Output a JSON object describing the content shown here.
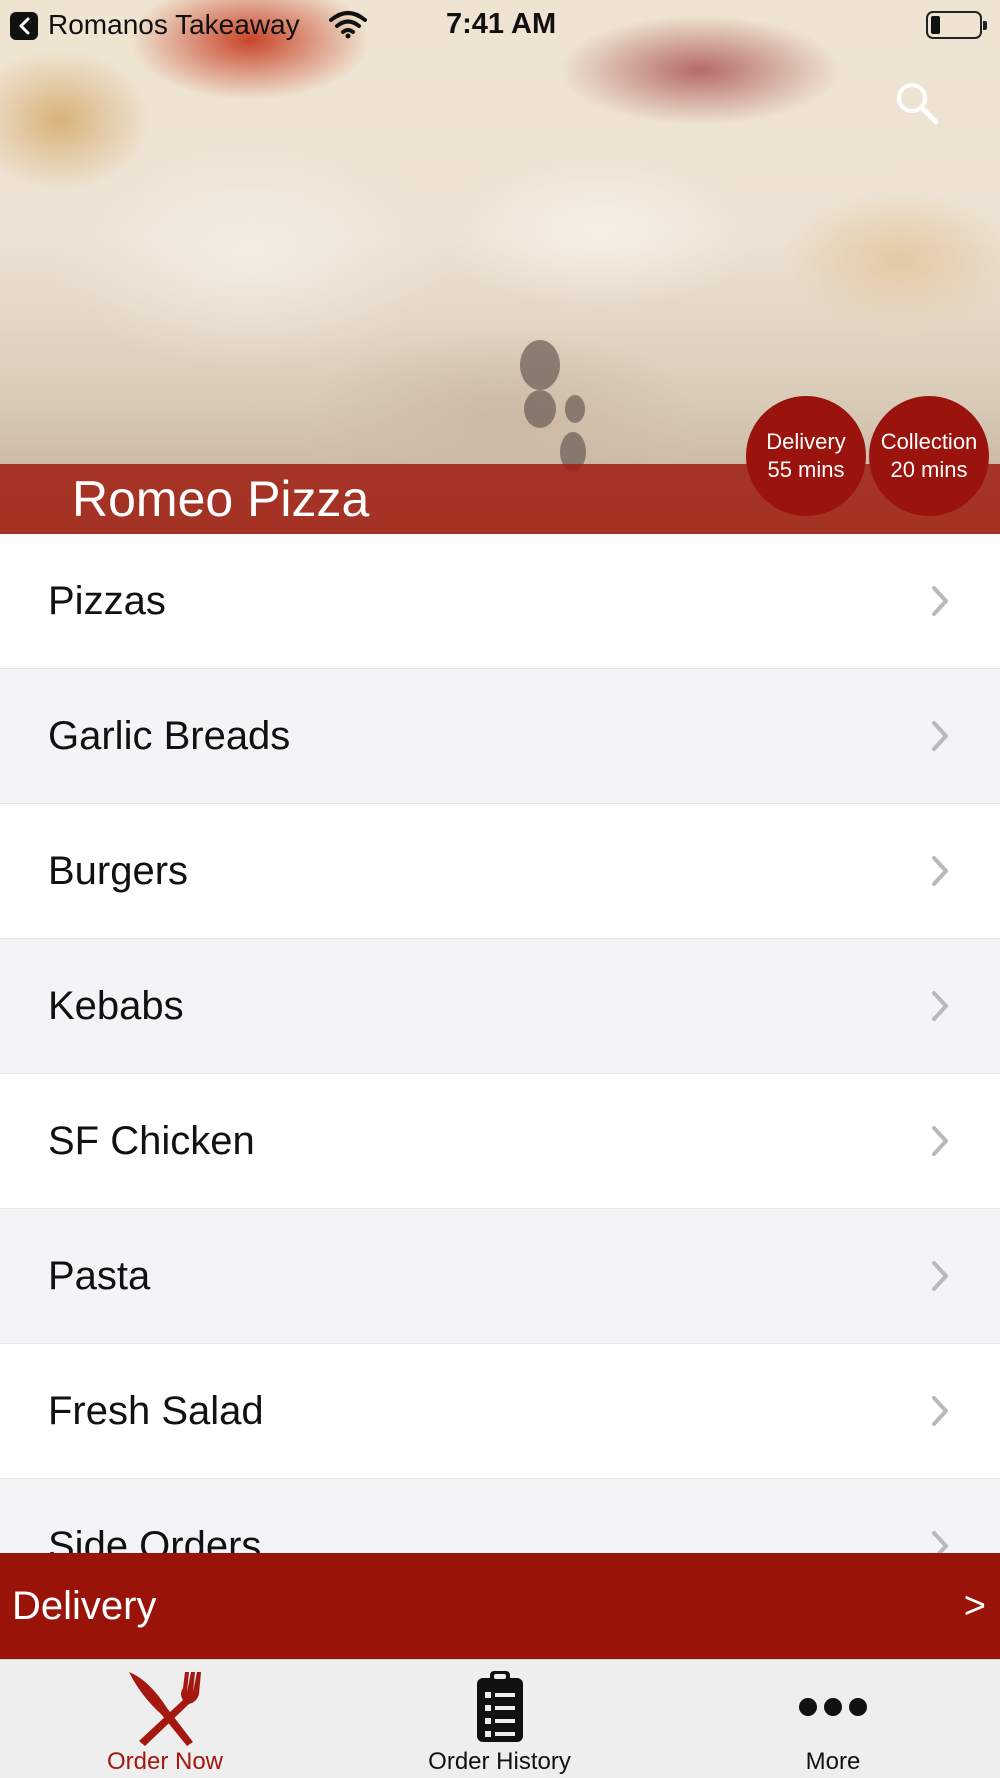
{
  "status_bar": {
    "back_app": "Romanos Takeaway",
    "time": "7:41 AM",
    "back_icon": "back-arrow-icon",
    "wifi_icon": "wifi-icon",
    "battery_icon": "battery-icon",
    "battery_level": 0.2
  },
  "header": {
    "title": "Romeo Pizza",
    "search_icon": "search-icon",
    "delivery": {
      "label": "Delivery",
      "time": "55 mins"
    },
    "collection": {
      "label": "Collection",
      "time": "20 mins"
    }
  },
  "menu": {
    "items": [
      {
        "label": "Pizzas"
      },
      {
        "label": "Garlic Breads"
      },
      {
        "label": "Burgers"
      },
      {
        "label": "Kebabs"
      },
      {
        "label": "SF Chicken"
      },
      {
        "label": "Pasta"
      },
      {
        "label": "Fresh Salad"
      },
      {
        "label": "Side Orders"
      }
    ],
    "chevron_icon": "chevron-right-icon"
  },
  "delivery_bar": {
    "label": "Delivery",
    "arrow": ">"
  },
  "tab_bar": {
    "tabs": [
      {
        "label": "Order Now",
        "icon": "fork-knife-icon",
        "active": true
      },
      {
        "label": "Order History",
        "icon": "clipboard-icon",
        "active": false
      },
      {
        "label": "More",
        "icon": "more-dots-icon",
        "active": false
      }
    ]
  },
  "colors": {
    "accent": "#9a1309",
    "active_tab": "#a5180f",
    "list_alt_bg": "#f3f4f6",
    "chevron": "#b9b9bd"
  }
}
